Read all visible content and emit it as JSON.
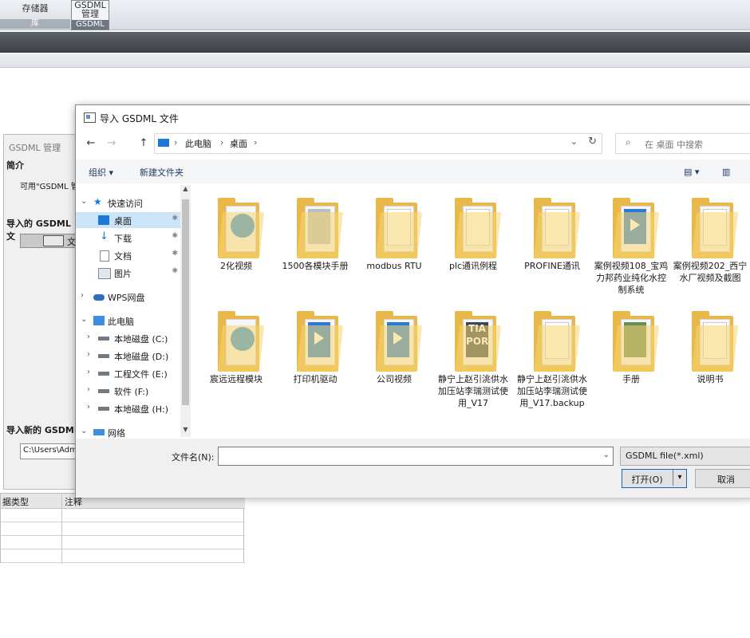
{
  "ribbon": {
    "storage_top": "存储器",
    "storage_bottom": "库",
    "gsdml_top": "GSDML\n管理",
    "gsdml_top_line1": "GSDML",
    "gsdml_top_line2": "管理",
    "gsdml_bottom": "GSDML"
  },
  "bg_panel": {
    "title": "GSDML 管理",
    "intro_heading": "简介",
    "intro_body": "可用\"GSDML 管",
    "imported_heading": "导入的 GSDML 文",
    "checkbox_label": "文",
    "import_new_heading": "导入新的 GSDML",
    "path_value": "C:\\Users\\Admin"
  },
  "bg_table": {
    "headers": [
      "据类型",
      "注释"
    ]
  },
  "dialog": {
    "title": "导入 GSDML 文件",
    "nav": {
      "back": "←",
      "forward": "→",
      "up": "↑",
      "refresh": "↻",
      "dropdown": "⌄"
    },
    "breadcrumb": [
      "此电脑",
      "桌面"
    ],
    "breadcrumb_sep": "›",
    "search_placeholder": "在 桌面 中搜索",
    "toolbar": {
      "organize": "组织 ▾",
      "new_folder": "新建文件夹",
      "view": "▤ ▾",
      "pane": "▥"
    },
    "nav_pane": [
      {
        "label": "快速访问",
        "exp": "⌄",
        "icon": "star-icon"
      },
      {
        "label": "桌面",
        "icon": "desktop-icon",
        "pin": "✱",
        "selected": true
      },
      {
        "label": "下载",
        "icon": "download-icon",
        "pin": "✱"
      },
      {
        "label": "文档",
        "icon": "document-icon",
        "pin": "✱"
      },
      {
        "label": "图片",
        "icon": "picture-icon",
        "pin": "✱"
      },
      {
        "label": "WPS网盘",
        "exp": "›",
        "icon": "cloud-icon"
      },
      {
        "label": "此电脑",
        "exp": "⌄",
        "icon": "computer-icon"
      },
      {
        "label": "本地磁盘 (C:)",
        "exp": "›",
        "icon": "drive-icon"
      },
      {
        "label": "本地磁盘 (D:)",
        "exp": "›",
        "icon": "drive-icon"
      },
      {
        "label": "工程文件 (E:)",
        "exp": "›",
        "icon": "drive-icon"
      },
      {
        "label": "软件 (F:)",
        "exp": "›",
        "icon": "drive-icon"
      },
      {
        "label": "本地磁盘 (H:)",
        "exp": "›",
        "icon": "drive-icon"
      },
      {
        "label": "网络",
        "exp": "⌄",
        "icon": "network-icon"
      }
    ],
    "files": [
      {
        "name": "2化视频",
        "thumb": "ie"
      },
      {
        "name": "1500各模块手册",
        "thumb": "grey"
      },
      {
        "name": "modbus RTU",
        "thumb": "doc"
      },
      {
        "name": "plc通讯例程",
        "thumb": "doc"
      },
      {
        "name": "PROFINE通讯",
        "thumb": "doc"
      },
      {
        "name": "案例视频108_宝鸡力邦药业纯化水控制系统",
        "thumb": "blue"
      },
      {
        "name": "案例视频202_西宁水厂视频及截图",
        "thumb": "doc"
      },
      {
        "name": "宸远远程模块",
        "thumb": "ie"
      },
      {
        "name": "打印机驱动",
        "thumb": "blue"
      },
      {
        "name": "公司视频",
        "thumb": "blue"
      },
      {
        "name": "静宁上赵引洮供水加压站李瑞测试使用_V17",
        "thumb": "dark",
        "thumb_text": "TIA\nPOR"
      },
      {
        "name": "静宁上赵引洮供水加压站李瑞测试使用_V17.backup",
        "thumb": "doc"
      },
      {
        "name": "手册",
        "thumb": "green"
      },
      {
        "name": "说明书",
        "thumb": "doc"
      }
    ],
    "filename_label": "文件名(N):",
    "filename_value": "",
    "filetype_value": "GSDML file(*.xml)",
    "open_label": "打开(O)",
    "cancel_label": "取消"
  },
  "colors": {
    "accent": "#1c79d8",
    "folder": "#f6d56f",
    "selection": "#cce4f7"
  }
}
